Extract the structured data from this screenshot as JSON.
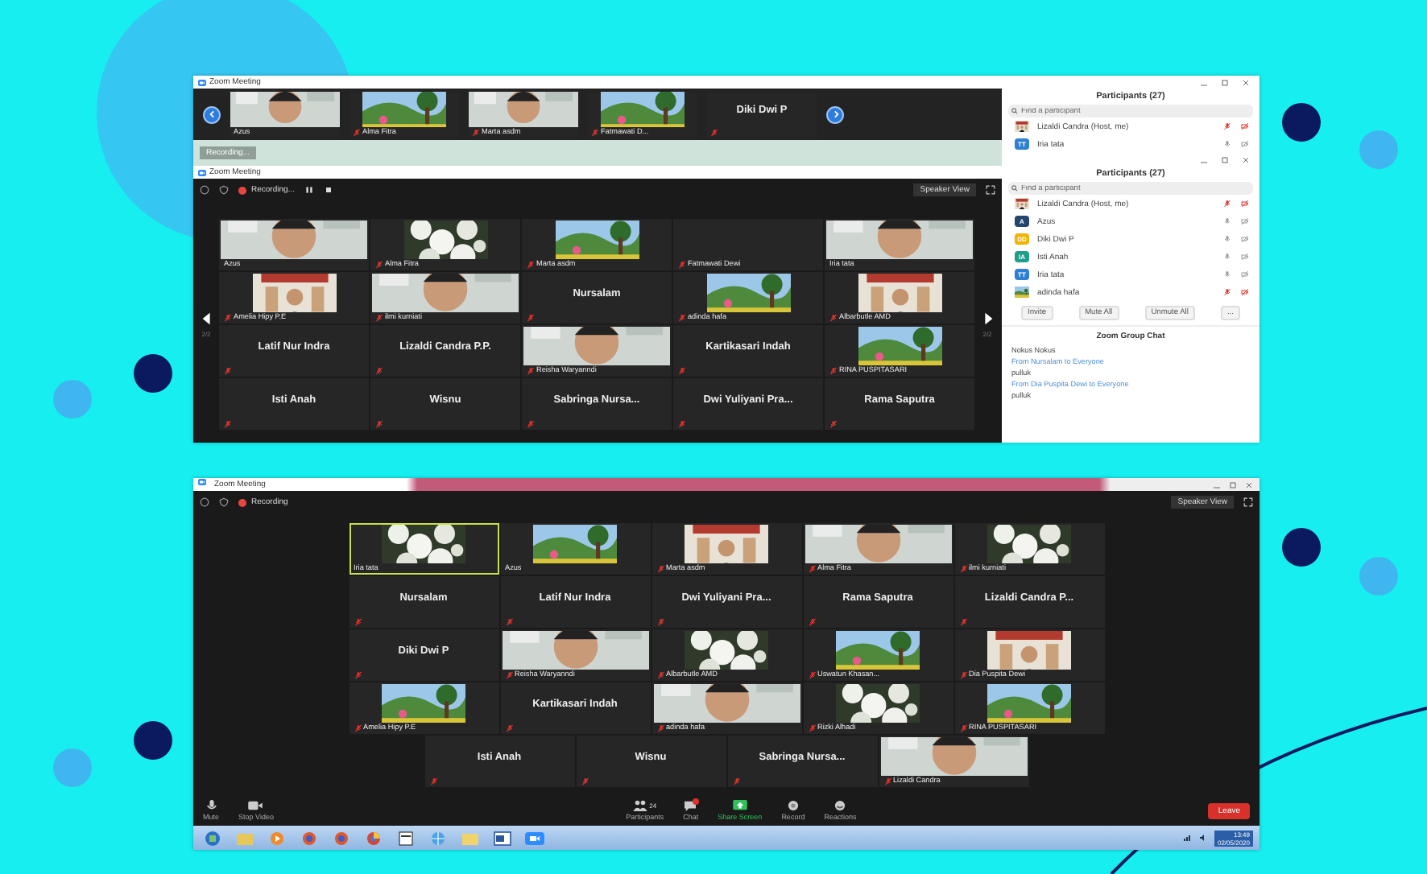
{
  "top_window": {
    "title": "Zoom Meeting",
    "strip": [
      {
        "name": "Azus",
        "kind": "video",
        "muted": false
      },
      {
        "name": "Alma Fitra",
        "kind": "video",
        "muted": true
      },
      {
        "name": "Marta asdm",
        "kind": "video",
        "muted": true
      },
      {
        "name": "Fatmawati D...",
        "kind": "video",
        "muted": true
      },
      {
        "name": "Diki Dwi P",
        "kind": "name",
        "muted": true
      }
    ],
    "recording_chip": "Recording...",
    "inner_title": "Zoom Meeting",
    "toolbar": {
      "recording": "Recording...",
      "view_button": "Speaker View"
    },
    "page_left": "2/2",
    "page_right": "2/2",
    "grid": [
      [
        {
          "name": "Azus",
          "kind": "video",
          "muted": false
        },
        {
          "name": "Alma Fitra",
          "kind": "video",
          "muted": true
        },
        {
          "name": "Marta asdm",
          "kind": "video",
          "muted": true
        },
        {
          "name": "Fatmawati Dewi",
          "kind": "label",
          "muted": true
        },
        {
          "name": "Iria tata",
          "kind": "video",
          "muted": false
        }
      ],
      [
        {
          "name": "Amelia Hipy P.E",
          "kind": "video",
          "muted": true
        },
        {
          "name": "ilmi kurniati",
          "kind": "video",
          "muted": true
        },
        {
          "name": "Nursalam",
          "kind": "name",
          "muted": true
        },
        {
          "name": "adinda hafa",
          "kind": "video",
          "muted": true
        },
        {
          "name": "Albarbutle AMD",
          "kind": "video",
          "muted": true
        }
      ],
      [
        {
          "name": "Latif Nur Indra",
          "kind": "name",
          "muted": true
        },
        {
          "name": "Lizaldi Candra P.P.",
          "kind": "name",
          "muted": true
        },
        {
          "name": "Reisha Waryanndi",
          "kind": "video",
          "muted": true
        },
        {
          "name": "Kartikasari Indah",
          "kind": "name",
          "muted": true
        },
        {
          "name": "RINA PUSPITASARI",
          "kind": "video",
          "muted": true
        }
      ],
      [
        {
          "name": "Isti Anah",
          "kind": "name",
          "muted": true
        },
        {
          "name": "Wisnu",
          "kind": "name",
          "muted": true
        },
        {
          "name": "Sabringa  Nursa...",
          "kind": "name",
          "muted": true
        },
        {
          "name": "Dwi  Yuliyani  Pra...",
          "kind": "name",
          "muted": true
        },
        {
          "name": "Rama Saputra",
          "kind": "name",
          "muted": true
        }
      ]
    ],
    "participants_panels": [
      {
        "title": "Participants (27)",
        "placeholder": "Find a participant",
        "rows": [
          {
            "name": "Lizaldi Candra (Host, me)",
            "muted": true
          },
          {
            "name": "Iria tata",
            "kind": "initials",
            "avatar": "TT",
            "color": "#2e7fd6",
            "muted": false
          }
        ]
      },
      {
        "title": "Participants (27)",
        "placeholder": "Find a participant",
        "rows": [
          {
            "name": "Lizaldi Candra (Host, me)",
            "muted": true
          },
          {
            "name": "Azus",
            "kind": "initials",
            "avatar": "A",
            "color": "#26456e",
            "muted": false
          },
          {
            "name": "Diki Dwi P",
            "kind": "initials",
            "avatar": "DD",
            "color": "#f0b400",
            "muted": false
          },
          {
            "name": "Isti Anah",
            "kind": "initials",
            "avatar": "IA",
            "color": "#1f9e8a",
            "muted": false
          },
          {
            "name": "Iria tata",
            "kind": "initials",
            "avatar": "TT",
            "color": "#2e7fd6",
            "muted": false
          },
          {
            "name": "adinda hafa",
            "muted": true
          }
        ],
        "buttons": [
          "Invite",
          "Mute All",
          "Unmute All",
          "..."
        ]
      }
    ],
    "chat": {
      "title": "Zoom Group Chat",
      "messages": [
        {
          "kind": "text",
          "text": "Nokus Nokus"
        },
        {
          "kind": "sender",
          "text": "From Nursalam to Everyone"
        },
        {
          "kind": "text",
          "text": "pulluk"
        },
        {
          "kind": "sender",
          "text": "From Dia Puspita Dewi to Everyone"
        },
        {
          "kind": "text",
          "text": "pulluk"
        }
      ]
    }
  },
  "bottom_window": {
    "title": "Zoom Meeting",
    "recording": "Recording",
    "view_button": "Speaker View",
    "grid": [
      [
        {
          "name": "Iria tata",
          "kind": "video",
          "muted": false,
          "speaking": true
        },
        {
          "name": "Azus",
          "kind": "video",
          "muted": false,
          "speaking": false
        },
        {
          "name": "Marta asdm",
          "kind": "video",
          "muted": true,
          "speaking": false
        },
        {
          "name": "Alma Fitra",
          "kind": "video",
          "muted": true,
          "speaking": false
        },
        {
          "name": "ilmi kurniati",
          "kind": "video",
          "muted": true,
          "speaking": false
        }
      ],
      [
        {
          "name": "Nursalam",
          "kind": "name",
          "muted": true,
          "speaking": false
        },
        {
          "name": "Latif Nur Indra",
          "kind": "name",
          "muted": true,
          "speaking": false
        },
        {
          "name": "Dwi  Yuliyani  Pra...",
          "kind": "name",
          "muted": true,
          "speaking": false
        },
        {
          "name": "Rama Saputra",
          "kind": "name",
          "muted": true,
          "speaking": false
        },
        {
          "name": "Lizaldi  Candra  P...",
          "kind": "name",
          "muted": true,
          "speaking": false
        }
      ],
      [
        {
          "name": "Diki Dwi P",
          "kind": "name",
          "muted": true,
          "speaking": false
        },
        {
          "name": "Reisha Waryanndi",
          "kind": "video",
          "muted": true,
          "speaking": false
        },
        {
          "name": "Albarbutle AMD",
          "kind": "video",
          "muted": true,
          "speaking": false
        },
        {
          "name": "Uswatun Khasan...",
          "kind": "video",
          "muted": true,
          "speaking": false
        },
        {
          "name": "Dia Puspita Dewi",
          "kind": "video",
          "muted": true,
          "speaking": false
        }
      ],
      [
        {
          "name": "Amelia Hipy P.E",
          "kind": "video",
          "muted": true,
          "speaking": false
        },
        {
          "name": "Kartikasari Indah",
          "kind": "name",
          "muted": true,
          "speaking": false
        },
        {
          "name": "adinda hafa",
          "kind": "video",
          "muted": true,
          "speaking": false
        },
        {
          "name": "Rizki Alhadi",
          "kind": "video",
          "muted": true,
          "speaking": false
        },
        {
          "name": "RINA PUSPITASARI",
          "kind": "video",
          "muted": true,
          "speaking": false
        }
      ],
      [
        {
          "name": "Isti Anah",
          "kind": "name",
          "muted": true,
          "speaking": false
        },
        {
          "name": "Wisnu",
          "kind": "name",
          "muted": true,
          "speaking": false
        },
        {
          "name": "Sabringa  Nursa...",
          "kind": "name",
          "muted": true,
          "speaking": false
        },
        {
          "name": "Lizaldi Candra",
          "kind": "video",
          "muted": true,
          "speaking": false
        }
      ]
    ],
    "toolbar": [
      {
        "label": "Mute",
        "kind": "mic"
      },
      {
        "label": "Stop Video",
        "kind": "camera"
      },
      {
        "label": "Participants",
        "kind": "people",
        "count": "24"
      },
      {
        "label": "Chat",
        "kind": "chat"
      },
      {
        "label": "Share Screen",
        "kind": "share"
      },
      {
        "label": "Record",
        "kind": "record"
      },
      {
        "label": "Reactions",
        "kind": "reactions"
      }
    ],
    "leave_button": "Leave",
    "taskbar": {
      "time": "13:49",
      "date": "02/05/2020"
    }
  }
}
